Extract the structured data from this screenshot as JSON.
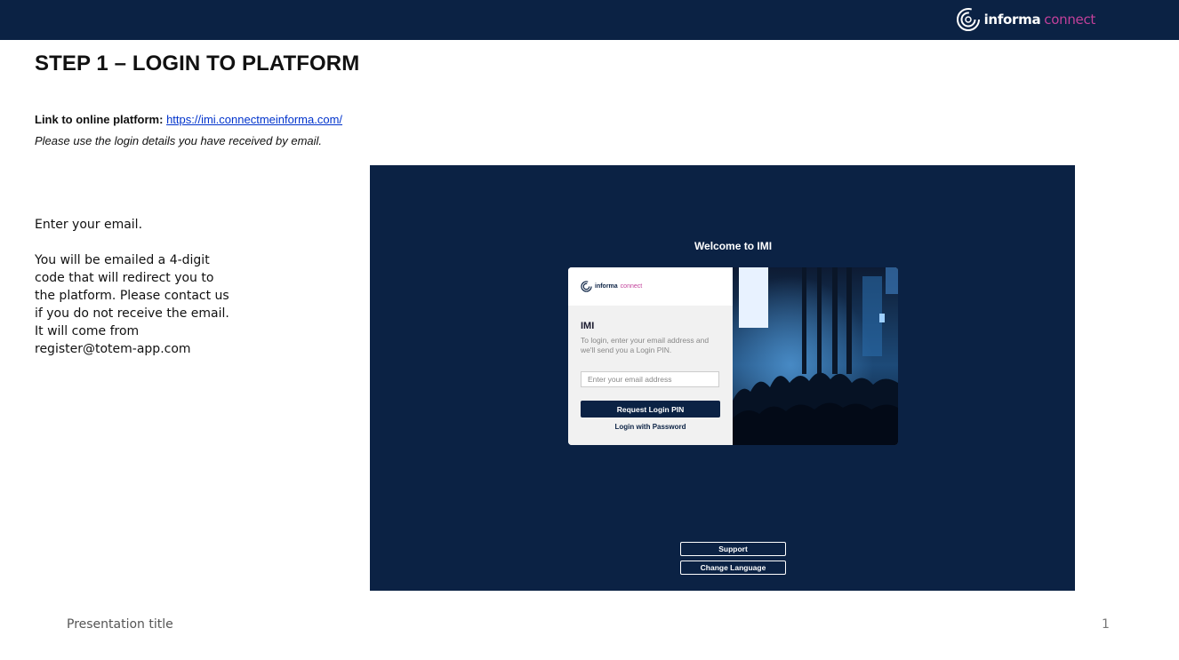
{
  "header": {
    "brand_word1": "informa",
    "brand_word2": "connect",
    "logo_icon": "informa-connect-swirl-icon"
  },
  "slide": {
    "title": "STEP 1 – LOGIN TO PLATFORM",
    "link_label": "Link to online platform:",
    "link_url": "https://imi.connectmeinforma.com/",
    "note": "Please use the login details you have received by email.",
    "instructions": [
      "Enter your email.",
      "You will be emailed a 4-digit code that will redirect you to the platform. Please contact us if you do not receive the email.  It will come from register@totem-app.com"
    ]
  },
  "login_screen": {
    "welcome": "Welcome to IMI",
    "card_logo_w1": "informa",
    "card_logo_w2": "connect",
    "heading": "IMI",
    "description": "To login, enter your email address and we'll send you a Login PIN.",
    "email_placeholder": "Enter your email address",
    "request_pin_label": "Request Login PIN",
    "password_link_label": "Login with Password",
    "support_label": "Support",
    "language_label": "Change Language",
    "image_subject": "concert-crowd-photo"
  },
  "footer": {
    "presentation_title": "Presentation title",
    "page_number": "1"
  },
  "colors": {
    "navy": "#0b2244",
    "magenta": "#c2409a",
    "link_blue": "#0033cc"
  }
}
